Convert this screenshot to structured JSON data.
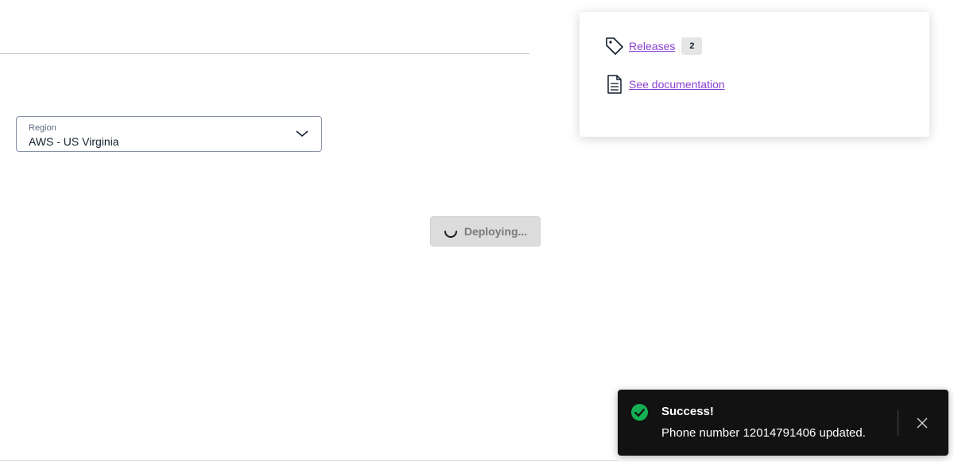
{
  "region": {
    "label": "Region",
    "value": "AWS - US Virginia"
  },
  "deploy": {
    "label": "Deploying..."
  },
  "resources": {
    "releases_label": "Releases",
    "releases_count": "2",
    "docs_label": "See documentation",
    "icons": [
      "tag-icon",
      "document-icon"
    ]
  },
  "toast": {
    "title": "Success!",
    "message": "Phone number 12014791406 updated.",
    "status_color": "#14b053",
    "icons": [
      "check-circle-icon",
      "close-icon"
    ]
  },
  "colors": {
    "link": "#8b3fd1",
    "toast_background": "#121212",
    "button_disabled": "#dcdcdc"
  }
}
